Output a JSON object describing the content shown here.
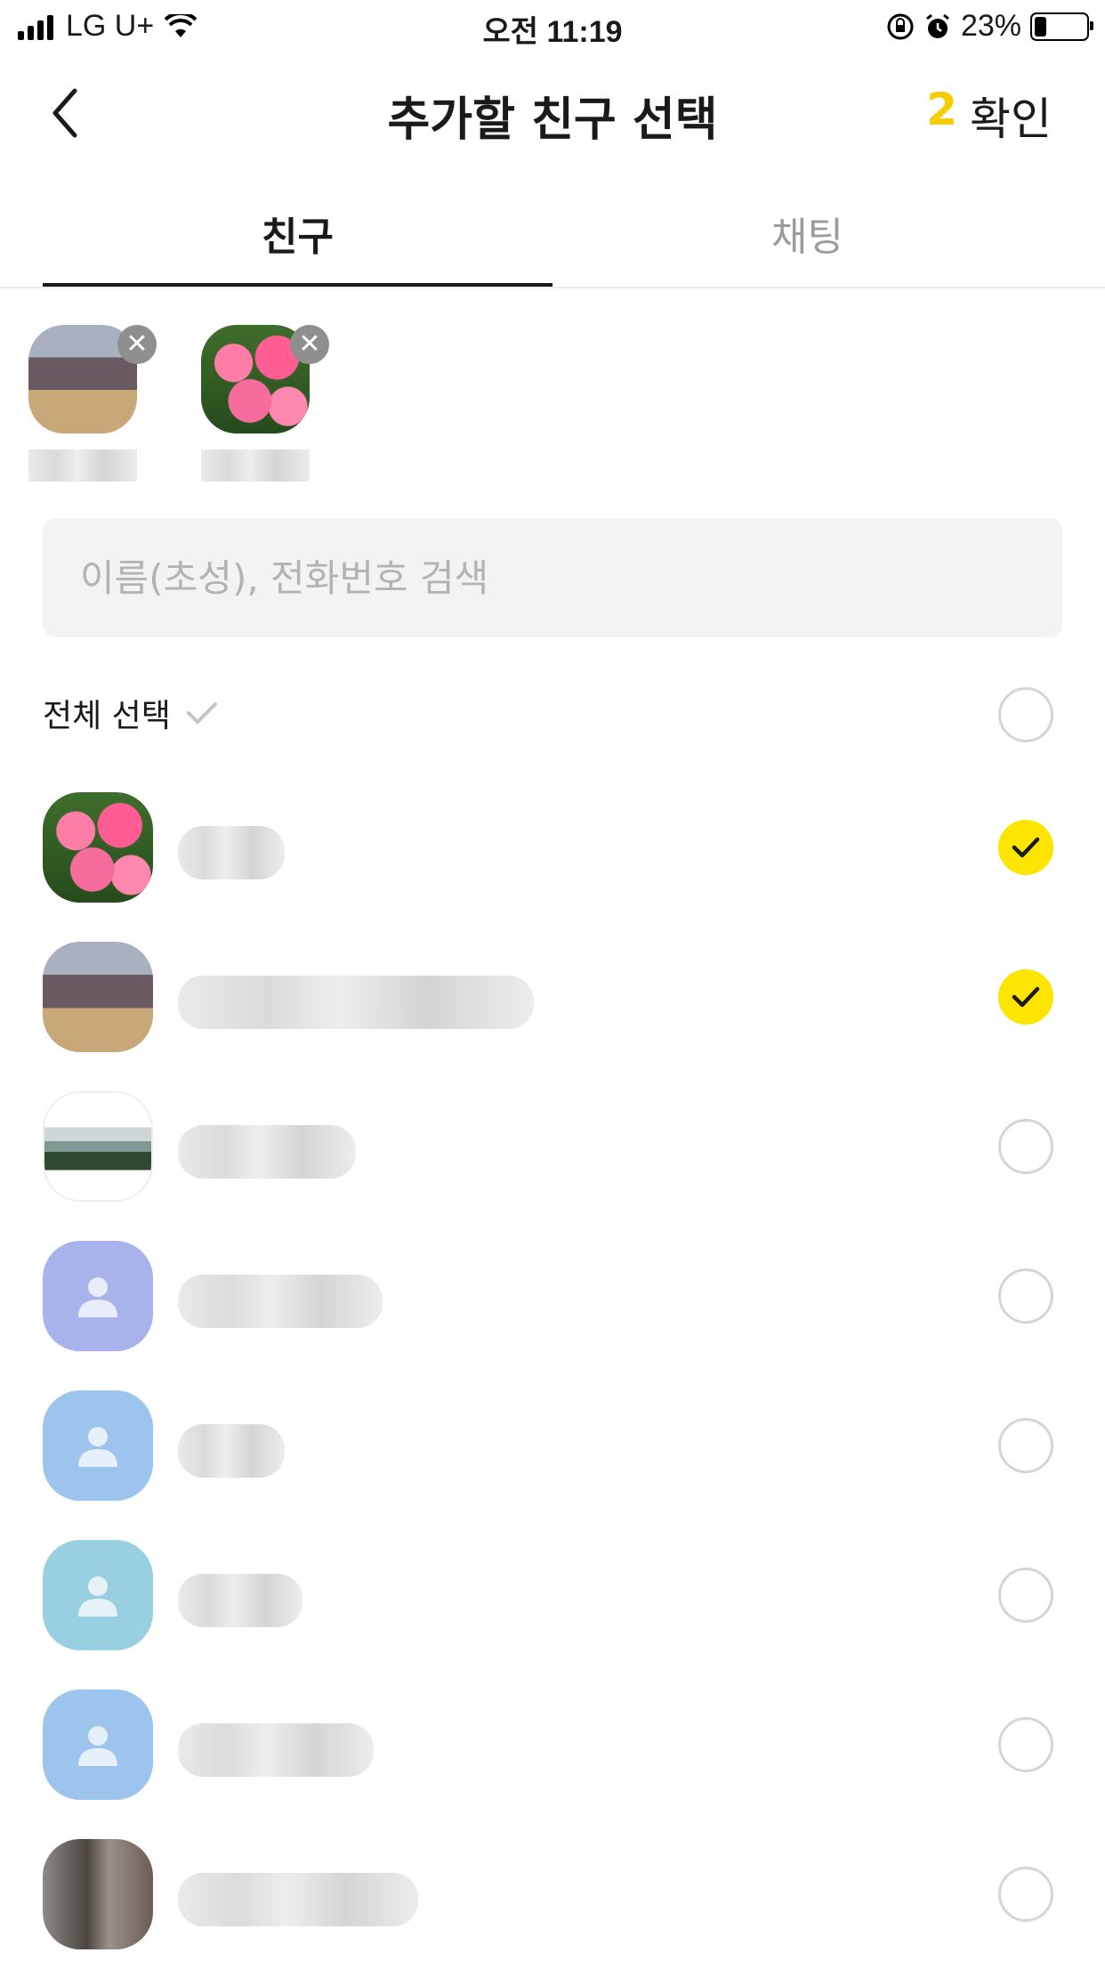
{
  "status_bar": {
    "carrier": "LG U+",
    "time": "오전 11:19",
    "battery": "23%",
    "battery_level": 0.23
  },
  "nav": {
    "title": "추가할 친구 선택",
    "selected_count": "2",
    "confirm_label": "확인"
  },
  "tabs": [
    {
      "label": "친구",
      "active": true
    },
    {
      "label": "채팅",
      "active": false
    }
  ],
  "search": {
    "placeholder": "이름(초성), 전화번호 검색"
  },
  "select_all": {
    "label": "전체 선택"
  },
  "selected_chips": [
    {
      "avatar": "photo"
    },
    {
      "avatar": "flower"
    }
  ],
  "friends": [
    {
      "avatar": "flower",
      "checked": true
    },
    {
      "avatar": "photo",
      "checked": true
    },
    {
      "avatar": "landscape",
      "checked": false
    },
    {
      "avatar": "default-purple",
      "checked": false
    },
    {
      "avatar": "default-blue",
      "checked": false
    },
    {
      "avatar": "default-teal",
      "checked": false
    },
    {
      "avatar": "default-blue",
      "checked": false
    },
    {
      "avatar": "photo",
      "checked": false
    }
  ],
  "colors": {
    "accent": "#fee500",
    "count": "#f6cd00",
    "avatar_purple": "#a8b3ec",
    "avatar_blue": "#9cc4ec",
    "avatar_teal": "#98d0e2"
  }
}
